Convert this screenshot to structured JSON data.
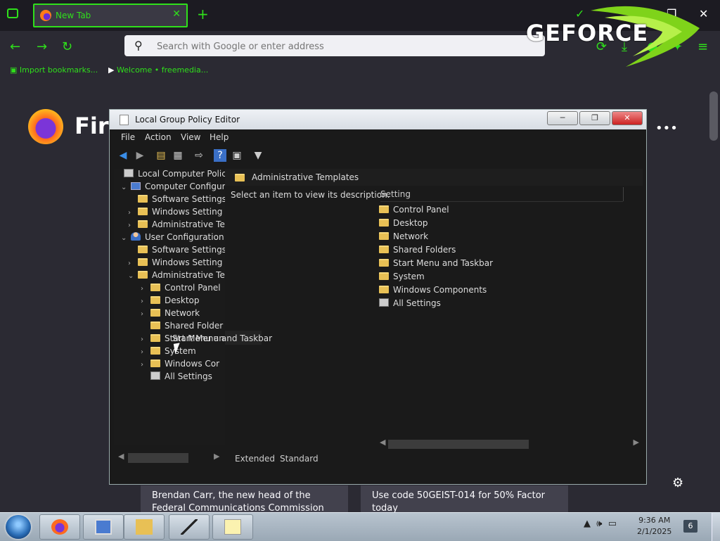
{
  "browser": {
    "tab_title": "New Tab",
    "tab_close": "✕",
    "new_tab": "+",
    "search_placeholder": "Search with Google or enter address",
    "bookmarks": [
      "Import bookmarks...",
      "Welcome • freemedia..."
    ],
    "overlay_text": "GEFORCE",
    "window_controls": [
      "─",
      "❐",
      "✕"
    ]
  },
  "newtab_page": {
    "logo_text": "Fire",
    "menu_dots": "•••",
    "cards": [
      "Brendan Carr, the new head of the Federal Communications Commission under",
      "Use code 50GEIST-014 for 50% Factor today"
    ]
  },
  "gpo": {
    "title": "Local Group Policy Editor",
    "title_buttons": [
      "─",
      "❐",
      "✕"
    ],
    "menu": [
      "File",
      "Action",
      "View",
      "Help"
    ],
    "toolbar": [
      "back-icon",
      "forward-icon",
      "up-folder-icon",
      "show-hide-tree-icon",
      "export-list-icon",
      "help-icon",
      "properties-icon",
      "filter-icon"
    ],
    "tree": [
      {
        "label": "Local Computer Policy",
        "level": 0,
        "icon": "policy",
        "exp": ""
      },
      {
        "label": "Computer Configura",
        "level": 1,
        "icon": "pc",
        "exp": "v"
      },
      {
        "label": "Software Settings",
        "level": 2,
        "icon": "folder",
        "exp": ""
      },
      {
        "label": "Windows Setting",
        "level": 2,
        "icon": "folder",
        "exp": ">"
      },
      {
        "label": "Administrative Te",
        "level": 2,
        "icon": "folder",
        "exp": ">"
      },
      {
        "label": "User Configuration",
        "level": 1,
        "icon": "user",
        "exp": "v"
      },
      {
        "label": "Software Settings",
        "level": 2,
        "icon": "folder",
        "exp": ""
      },
      {
        "label": "Windows Setting",
        "level": 2,
        "icon": "folder",
        "exp": ">"
      },
      {
        "label": "Administrative Te",
        "level": 2,
        "icon": "folder",
        "exp": "v"
      },
      {
        "label": "Control Panel",
        "level": 3,
        "icon": "folder",
        "exp": ">"
      },
      {
        "label": "Desktop",
        "level": 3,
        "icon": "folder",
        "exp": ">"
      },
      {
        "label": "Network",
        "level": 3,
        "icon": "folder",
        "exp": ">"
      },
      {
        "label": "Shared Folder",
        "level": 3,
        "icon": "folder",
        "exp": ""
      },
      {
        "label": "Start Menu and Taskbar",
        "level": 3,
        "icon": "folder",
        "exp": ">"
      },
      {
        "label": "System",
        "level": 3,
        "icon": "folder",
        "exp": ">"
      },
      {
        "label": "Windows Cor",
        "level": 3,
        "icon": "folder",
        "exp": ">"
      },
      {
        "label": "All Settings",
        "level": 3,
        "icon": "settings",
        "exp": ""
      }
    ],
    "right_title": "Administrative Templates",
    "description": "Select an item to view its description.",
    "column_header": "Setting",
    "items": [
      {
        "label": "Control Panel",
        "icon": "folder"
      },
      {
        "label": "Desktop",
        "icon": "folder"
      },
      {
        "label": "Network",
        "icon": "folder"
      },
      {
        "label": "Shared Folders",
        "icon": "folder"
      },
      {
        "label": "Start Menu and Taskbar",
        "icon": "folder"
      },
      {
        "label": "System",
        "icon": "folder"
      },
      {
        "label": "Windows Components",
        "icon": "folder"
      },
      {
        "label": "All Settings",
        "icon": "settings"
      }
    ],
    "view_tabs": [
      "Extended",
      "Standard"
    ]
  },
  "taskbar": {
    "time": "9:36 AM",
    "date": "2/1/2025",
    "notification_count": "6",
    "apps": [
      "firefox-icon",
      "computer-icon",
      "folder-icon",
      "editor-icon",
      "notepad-icon"
    ]
  },
  "colors": {
    "accent": "#2fe01b",
    "window_bg": "#1a1a1a"
  }
}
